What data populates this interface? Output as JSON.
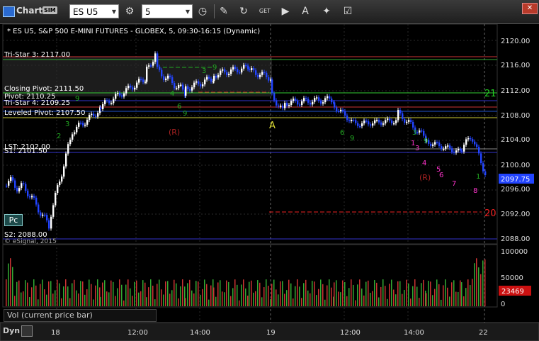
{
  "window": {
    "title": "Chart",
    "badge": "SIM",
    "close": "✕"
  },
  "toolbar": {
    "symbol": "ES U5",
    "interval": "5",
    "buttons": [
      "gear-icon",
      "clock-icon",
      "pencil-icon",
      "refresh-icon",
      "get-icon",
      "play-icon",
      "text-icon",
      "tag-icon",
      "checkbox-icon"
    ]
  },
  "chart_title": "* ES U5, S&P 500 E-MINI FUTURES - GLOBEX, 5, 09:30-16:15 (Dynamic)",
  "price_axis": {
    "ticks": [
      "2120.00",
      "2116.00",
      "2112.00",
      "2108.00",
      "2104.00",
      "2100.00",
      "2096.00",
      "2092.00",
      "2088.00"
    ],
    "last_price": "2097.75"
  },
  "volume_axis": {
    "ticks": [
      "100000",
      "50000",
      "0"
    ],
    "last_volume": "23469"
  },
  "time_axis": {
    "ticks": [
      "18",
      "12:00",
      "14:00",
      "19",
      "12:00",
      "14:00",
      "22"
    ]
  },
  "levels": [
    {
      "label": "Tri-Star 3: 2117.00",
      "color": "#cc3333"
    },
    {
      "label": "Closing Pivot: 2111.50",
      "color": "#33cc33"
    },
    {
      "label": "Pivot: 2110.25",
      "color": "#3333cc"
    },
    {
      "label": "Tri-Star 4: 2109.25",
      "color": "#cc3333"
    },
    {
      "label": "Leveled Pivot: 2107.50",
      "color": "#cccc33"
    },
    {
      "label": "LST: 2102.00",
      "color": "#888888"
    },
    {
      "label": "S1: 2101.50",
      "color": "#3333cc"
    },
    {
      "label": "S2: 2088.00",
      "color": "#3333cc"
    }
  ],
  "annotations": {
    "pc": "Pc",
    "r1": "(R)",
    "r2": "(R)",
    "a": "A",
    "n21": "21",
    "n20": "20",
    "copyright": "© eSignal, 2015"
  },
  "volume_panel_label": "Vol (current price bar)",
  "footer": {
    "dyn": "Dyn"
  },
  "colors": {
    "up": "#ffffff",
    "down": "#2244ff",
    "pink": "#ff33cc",
    "green": "#22aa22",
    "dark_red": "#aa2222"
  }
}
